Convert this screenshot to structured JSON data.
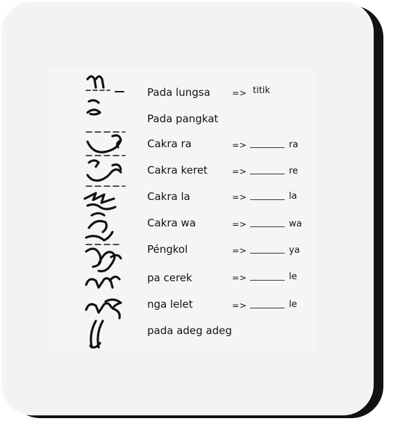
{
  "rows": [
    {
      "label": "Pada lungsa",
      "arrow": "=>",
      "blank": false,
      "value": "titik"
    },
    {
      "label": "Pada pangkat",
      "arrow": "",
      "blank": false,
      "value": ""
    },
    {
      "label": "Cakra ra",
      "arrow": "=>",
      "blank": true,
      "value": "ra"
    },
    {
      "label": "Cakra keret",
      "arrow": "=>",
      "blank": true,
      "value": "re"
    },
    {
      "label": "Cakra la",
      "arrow": "=>",
      "blank": true,
      "value": "la"
    },
    {
      "label": "Cakra wa",
      "arrow": "=>",
      "blank": true,
      "value": "wa"
    },
    {
      "label": "Péngkol",
      "arrow": "=>",
      "blank": true,
      "value": "ya"
    },
    {
      "label": "pa cerek",
      "arrow": "=>",
      "blank": true,
      "value": "le"
    },
    {
      "label": "nga lelet",
      "arrow": "=>",
      "blank": true,
      "value": "le"
    },
    {
      "label": "pada adeg adeg",
      "arrow": "",
      "blank": false,
      "value": ""
    }
  ]
}
